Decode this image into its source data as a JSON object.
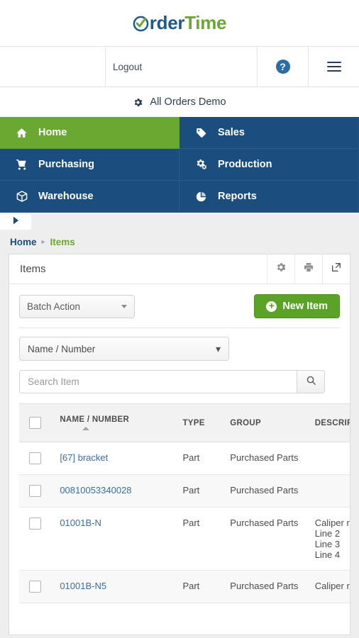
{
  "brand": {
    "name_part1": "rder",
    "name_part2": "Time",
    "logo_icon": "check-circle-o-icon",
    "color_blue": "#1b5a8c",
    "color_green": "#6aa832"
  },
  "utilbar": {
    "logout_label": "Logout",
    "help_icon": "question-circle-icon",
    "help_label": "?",
    "menu_icon": "hamburger-menu-icon"
  },
  "company": {
    "gear_icon": "gear-icon",
    "name": "All Orders Demo"
  },
  "nav": {
    "tiles": [
      {
        "label": "Home",
        "icon": "home-icon",
        "active": true
      },
      {
        "label": "Sales",
        "icon": "tag-icon",
        "active": false
      },
      {
        "label": "Purchasing",
        "icon": "cart-icon",
        "active": false
      },
      {
        "label": "Production",
        "icon": "gears-icon",
        "active": false
      },
      {
        "label": "Warehouse",
        "icon": "box-icon",
        "active": false
      },
      {
        "label": "Reports",
        "icon": "pie-chart-icon",
        "active": false
      }
    ],
    "active_color": "#6aa832",
    "base_color": "#1b4d7e"
  },
  "sidebar_toggle": {
    "icon": "caret-right-icon"
  },
  "breadcrumb": {
    "home": "Home",
    "separator": "▸",
    "current": "Items"
  },
  "panel": {
    "title": "Items",
    "actions": [
      {
        "name": "settings-icon",
        "label": "gear"
      },
      {
        "name": "print-icon",
        "label": "printer"
      },
      {
        "name": "export-icon",
        "label": "export"
      }
    ]
  },
  "toolbar": {
    "batch_action_label": "Batch Action",
    "new_item_label": "New Item",
    "new_item_icon": "plus-circle-icon",
    "new_item_color": "#5aa326"
  },
  "filters": {
    "field_select_value": "Name / Number",
    "search_placeholder": "Search Item",
    "search_value": "",
    "search_icon": "search-icon"
  },
  "table": {
    "columns": [
      {
        "key": "chk",
        "label": ""
      },
      {
        "key": "name",
        "label": "NAME / NUMBER",
        "sort": "asc"
      },
      {
        "key": "type",
        "label": "TYPE"
      },
      {
        "key": "grp",
        "label": "GROUP"
      },
      {
        "key": "desc",
        "label": "DESCRIPTION"
      }
    ],
    "rows": [
      {
        "name": "[67] bracket",
        "type": "Part",
        "group": "Purchased Parts",
        "description": [
          "",
          "",
          "",
          ""
        ]
      },
      {
        "name": "00810053340028",
        "type": "Part",
        "group": "Purchased Parts",
        "description": [
          "",
          "",
          "",
          ""
        ]
      },
      {
        "name": "01001B-N",
        "type": "Part",
        "group": "Purchased Parts",
        "description": [
          "Caliper rep",
          "Line 2",
          "Line 3",
          "Line 4"
        ]
      },
      {
        "name": "01001B-N5",
        "type": "Part",
        "group": "Purchased Parts",
        "description": [
          "Caliper rep",
          "",
          "",
          ""
        ]
      }
    ]
  }
}
